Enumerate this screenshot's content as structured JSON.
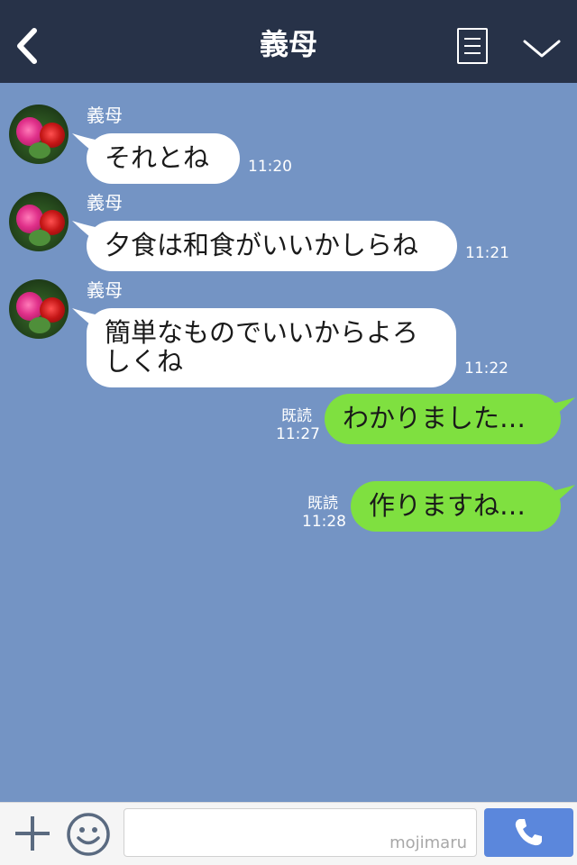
{
  "header": {
    "title": "義母",
    "back_icon": "chevron-left-icon",
    "menu_icon": "list-menu-icon",
    "dropdown_icon": "chevron-down-icon",
    "background": "#273248"
  },
  "chat": {
    "background": "#7494c4",
    "messages": [
      {
        "direction": "incoming",
        "sender": "義母",
        "text": "それとね",
        "time": "11:20"
      },
      {
        "direction": "incoming",
        "sender": "義母",
        "text": "夕食は和食がいいかしらね",
        "time": "11:21"
      },
      {
        "direction": "incoming",
        "sender": "義母",
        "text_line1": "簡単なものでいいからよろ",
        "text_line2": "しくね",
        "time": "11:22"
      },
      {
        "direction": "outgoing",
        "read_label": "既読",
        "text": "わかりました…",
        "time": "11:27"
      },
      {
        "direction": "outgoing",
        "read_label": "既読",
        "text": "作りますね…",
        "time": "11:28"
      }
    ],
    "incoming_bubble_color": "#ffffff",
    "outgoing_bubble_color": "#7fe040"
  },
  "footer": {
    "plus_icon": "plus-icon",
    "emoji_icon": "smiley-icon",
    "input_value": "",
    "watermark": "mojimaru",
    "call_icon": "phone-icon",
    "call_button_color": "#5b87dc"
  }
}
